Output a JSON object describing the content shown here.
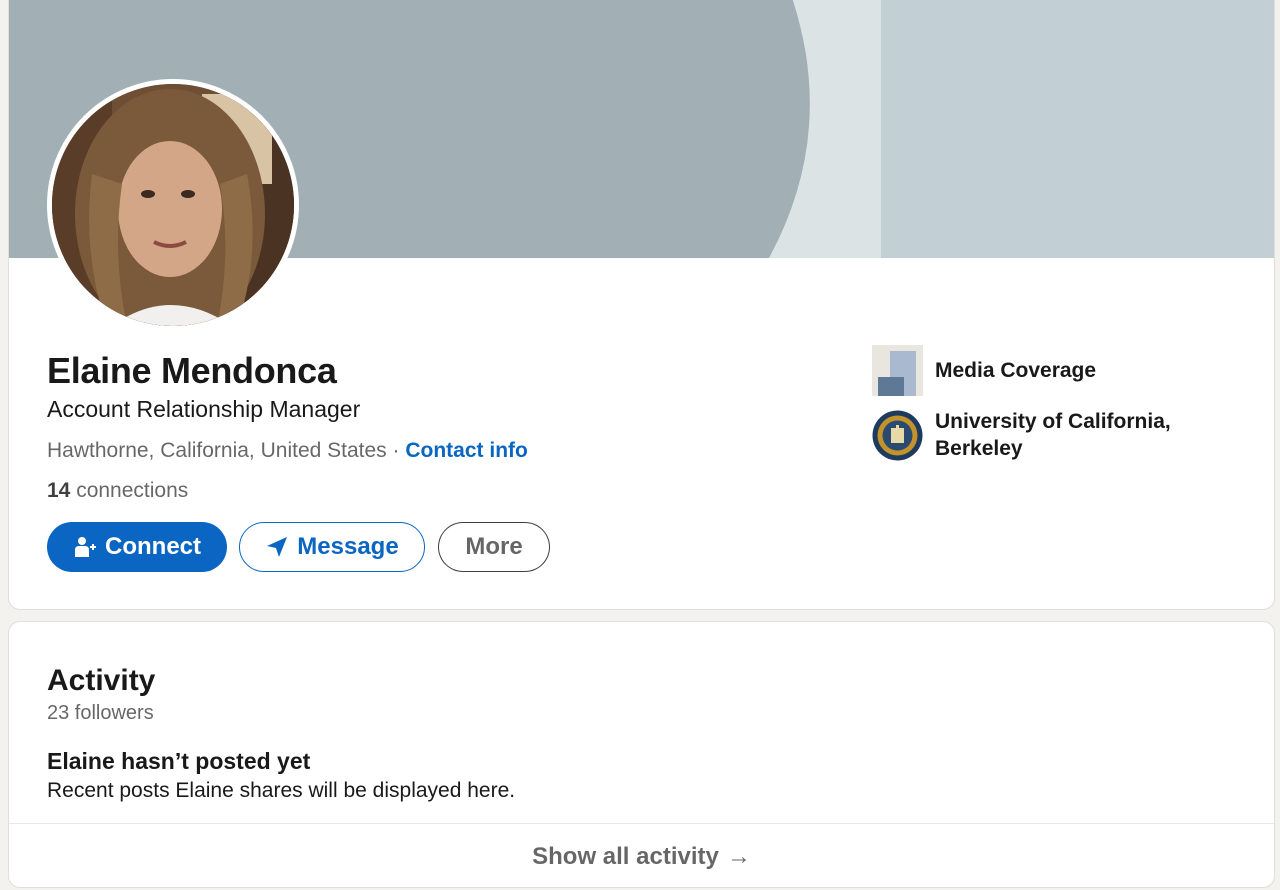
{
  "profile": {
    "name": "Elaine Mendonca",
    "headline": "Account Relationship Manager",
    "location": "Hawthorne, California, United States",
    "separator": "·",
    "contact_info_label": "Contact info",
    "connections_count": "14",
    "connections_label": "connections"
  },
  "actions": {
    "connect_label": "Connect",
    "message_label": "Message",
    "more_label": "More"
  },
  "sidebar": {
    "items": [
      {
        "label": "Media Coverage",
        "icon": "company-logo-icon"
      },
      {
        "label": "University of California, Berkeley",
        "icon": "university-seal-icon"
      }
    ]
  },
  "activity": {
    "title": "Activity",
    "followers": "23 followers",
    "empty_title": "Elaine hasn’t posted yet",
    "empty_desc": "Recent posts Elaine shares will be displayed here.",
    "show_all_label": "Show all activity",
    "arrow": "→"
  },
  "colors": {
    "brand_blue": "#0a66c2",
    "banner_primary": "#a2b0b5",
    "banner_secondary": "#c2d0d5",
    "page_background": "#f4f2ee"
  }
}
